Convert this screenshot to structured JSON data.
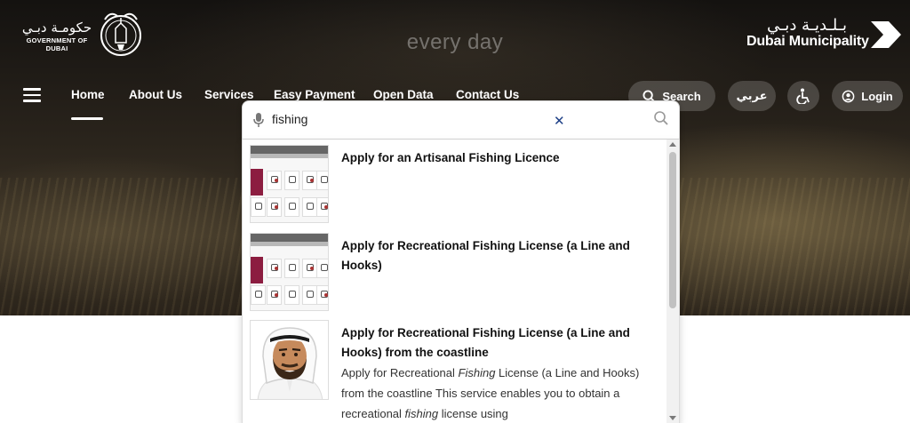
{
  "hero": {
    "tagline": "every day"
  },
  "header": {
    "gov_logo_ar": "حكومـة دبـي",
    "gov_logo_en": "GOVERNMENT OF DUBAI",
    "dm_logo_ar": "بـلـديـة دبـي",
    "dm_logo_en": "Dubai Municipality"
  },
  "nav": {
    "items": [
      {
        "label": "Home",
        "active": true
      },
      {
        "label": "About Us"
      },
      {
        "label": "Services"
      },
      {
        "label": "Easy Payment"
      },
      {
        "label": "Open Data"
      },
      {
        "label": "Contact Us"
      }
    ],
    "search_label": "Search",
    "language_label": "عربي",
    "login_label": "Login"
  },
  "search": {
    "value": "fishing",
    "results": [
      {
        "title": "Apply for an Artisanal Fishing Licence"
      },
      {
        "title": "Apply for Recreational Fishing License (a Line and Hooks)"
      },
      {
        "title": "Apply for Recreational Fishing License (a Line and Hooks) from the coastline",
        "desc_before": "Apply for Recreational ",
        "desc_em1": "Fishing",
        "desc_middle": " License (a Line and Hooks) from the coastline This service enables you to obtain a recreational ",
        "desc_em2": "fishing",
        "desc_after": " license using"
      }
    ]
  },
  "colors": {
    "accent": "#1d3f86",
    "maroon": "#8c1d40"
  }
}
